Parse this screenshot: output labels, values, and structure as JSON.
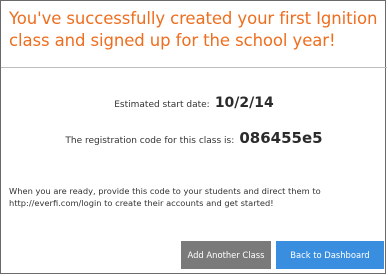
{
  "dialog": {
    "headline": "You've successfully created your first Ignition class and signed up for the school year!",
    "start_date": {
      "label": "Estimated start date:",
      "value": "10/2/14"
    },
    "registration_code": {
      "label": "The registration code for this class is:",
      "value": "086455e5"
    },
    "instructions_line1": "When you are ready, provide this code to your students and direct them to",
    "instructions_line2": "http://everfi.com/login to create their accounts and get started!",
    "buttons": {
      "add_another_class": "Add Another Class",
      "back_to_dashboard": "Back to Dashboard"
    },
    "colors": {
      "headline": "#ee6e1f",
      "gray_button": "#7a7a7a",
      "blue_button": "#3a8ee0"
    }
  }
}
